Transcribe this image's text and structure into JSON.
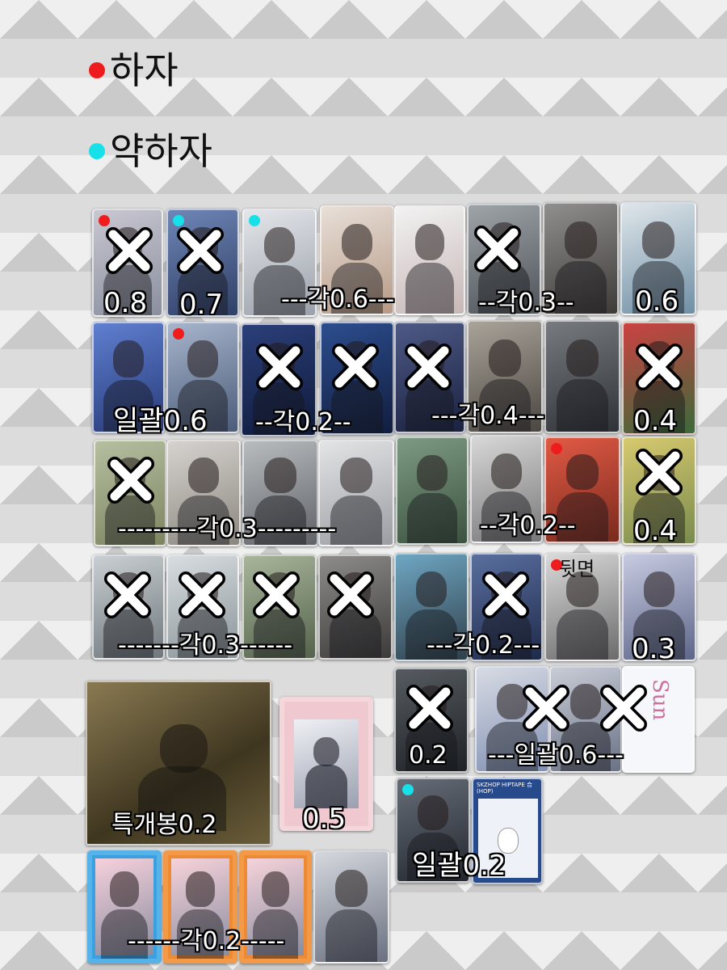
{
  "legend": {
    "defect": {
      "label": "하자",
      "color": "#ee1c1c"
    },
    "minor_defect": {
      "label": "약하자",
      "color": "#18e0e8"
    }
  },
  "price_labels": {
    "r1_a": "0.8",
    "r1_b": "0.7",
    "r1_c": "---각0.6---",
    "r1_d": "--각0.3--",
    "r1_e": "0.6",
    "r2_a": "일괄0.6",
    "r2_b": "--각0.2--",
    "r2_c": "---각0.4---",
    "r2_d": "0.4",
    "r3_a": "---------각0.3---------",
    "r3_b": "--각0.2--",
    "r3_c": "0.4",
    "r4_a": "-------각0.3------",
    "r4_b": "---각0.2---",
    "r4_c": "0.3",
    "back_note": "뒷면",
    "r5_a": "0.2",
    "r5_b": "---일괄0.6---",
    "album": "특개봉0.2",
    "polaroid": "0.5",
    "r6_a": "일괄0.2",
    "r7_a": "------각0.2-----"
  },
  "small_card_text": {
    "sun_card": "Sun",
    "tape_card_title": "SKZHOP HIPTAPE 合 (HOP)"
  },
  "colors": {
    "cross_fill": "#ffffff",
    "cross_outline": "#000000"
  }
}
